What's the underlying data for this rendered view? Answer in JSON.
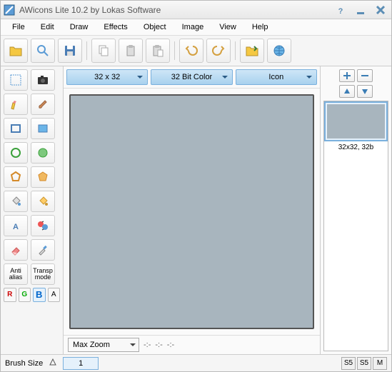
{
  "title": "AWicons Lite 10.2 by Lokas Software",
  "menus": [
    "File",
    "Edit",
    "Draw",
    "Effects",
    "Object",
    "Image",
    "View",
    "Help"
  ],
  "dropdowns": {
    "size": "32 x 32",
    "color": "32 Bit Color",
    "type": "Icon"
  },
  "zoom": "Max Zoom",
  "zoom_coords": [
    "-:-",
    "-:-",
    "-:-"
  ],
  "thumb_label": "32x32, 32b",
  "status": {
    "brush_label": "Brush Size",
    "brush_value": "1"
  },
  "opts": {
    "anti": "Anti\nalias",
    "transp": "Transp\nmode"
  },
  "channels": [
    "R",
    "G",
    "B",
    "A"
  ],
  "status_btns": [
    "S5",
    "S5",
    "M"
  ]
}
